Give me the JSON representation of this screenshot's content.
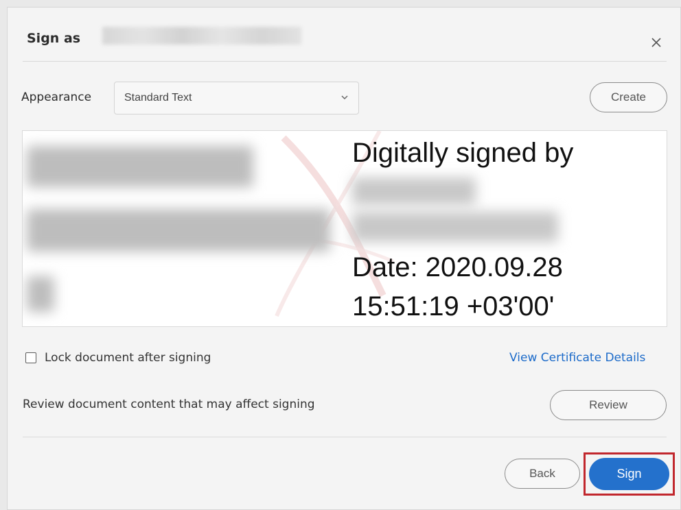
{
  "dialog": {
    "title_prefix": "Sign as",
    "close_icon": "close-icon"
  },
  "appearance": {
    "label": "Appearance",
    "selected": "Standard Text",
    "create_label": "Create"
  },
  "preview": {
    "line1": "Digitally signed by",
    "line2": "Date: 2020.09.28",
    "line3": "15:51:19 +03'00'"
  },
  "options": {
    "lock_label": "Lock document after signing",
    "lock_checked": false,
    "cert_link": "View Certificate Details"
  },
  "review": {
    "text": "Review document content that may affect signing",
    "button": "Review"
  },
  "footer": {
    "back_label": "Back",
    "sign_label": "Sign"
  },
  "colors": {
    "accent": "#2471cc",
    "link": "#1b6ac9",
    "highlight": "#c1272d"
  }
}
